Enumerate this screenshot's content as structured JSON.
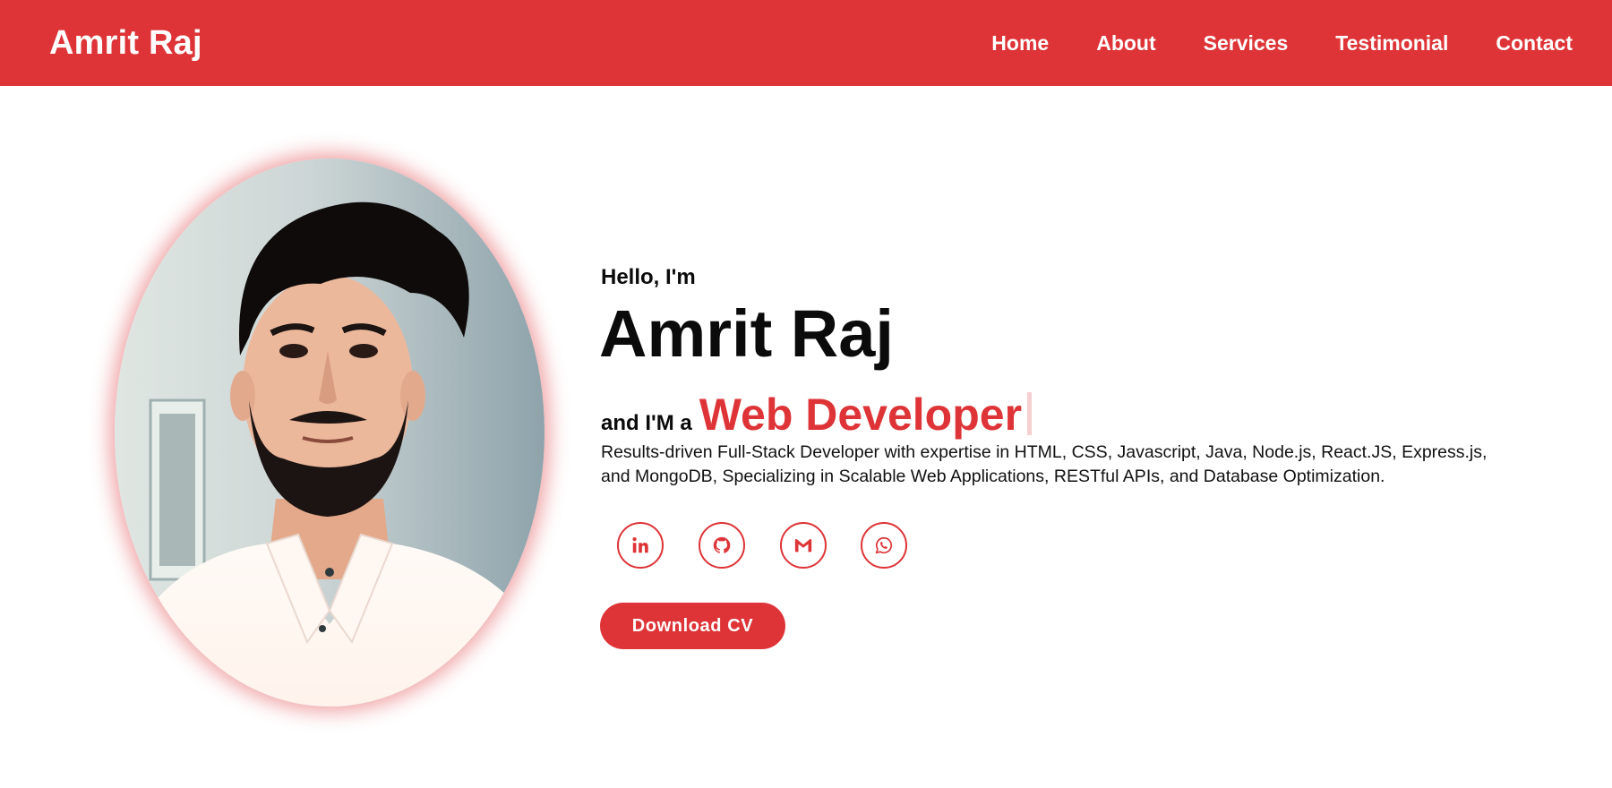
{
  "header": {
    "brand": "Amrit Raj",
    "nav": [
      {
        "label": "Home"
      },
      {
        "label": "About"
      },
      {
        "label": "Services"
      },
      {
        "label": "Testimonial"
      },
      {
        "label": "Contact"
      }
    ]
  },
  "hero": {
    "greeting": "Hello, I'm",
    "name": "Amrit Raj",
    "role_prefix": "and I'M a",
    "role": "Web Developer",
    "bio": "Results-driven Full-Stack Developer with expertise in HTML, CSS, Javascript, Java, Node.js, React.JS, Express.js, and MongoDB, Specializing in Scalable Web Applications, RESTful APIs, and Database Optimization.",
    "photo_alt": "profile photo",
    "socials": [
      {
        "icon": "linkedin-icon"
      },
      {
        "icon": "github-icon"
      },
      {
        "icon": "gmail-icon"
      },
      {
        "icon": "whatsapp-icon"
      }
    ],
    "cta_label": "Download CV"
  },
  "colors": {
    "accent": "#de3437",
    "text": "#0b0b0b",
    "background": "#ffffff"
  }
}
